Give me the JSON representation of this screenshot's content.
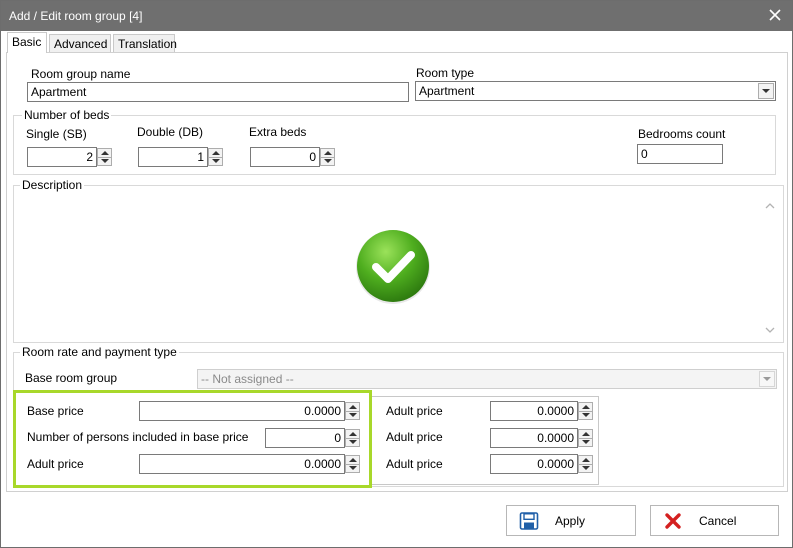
{
  "window": {
    "title": "Add / Edit room group [4]"
  },
  "tabs": [
    "Basic",
    "Advanced",
    "Translation"
  ],
  "basic": {
    "room_group_name_label": "Room group name",
    "room_group_name_value": "Apartment",
    "room_type_label": "Room type",
    "room_type_value": "Apartment",
    "beds": {
      "group_label": "Number of beds",
      "single_label": "Single (SB)",
      "single_value": "2",
      "double_label": "Double (DB)",
      "double_value": "1",
      "extra_label": "Extra beds",
      "extra_value": "0",
      "bedrooms_label": "Bedrooms count",
      "bedrooms_value": "0"
    },
    "description_label": "Description",
    "rate": {
      "group_label": "Room rate and payment type",
      "base_room_group_label": "Base room group",
      "base_room_group_value": "-- Not assigned --",
      "left": [
        {
          "label": "Base price",
          "value": "0.0000"
        },
        {
          "label": "Number of persons included in base price",
          "value": "0"
        },
        {
          "label": "Adult price",
          "value": "0.0000"
        }
      ],
      "right": [
        {
          "label": "Adult price",
          "value": "0.0000"
        },
        {
          "label": "Adult price",
          "value": "0.0000"
        },
        {
          "label": "Adult price",
          "value": "0.0000"
        }
      ]
    }
  },
  "buttons": {
    "apply": "Apply",
    "cancel": "Cancel"
  },
  "colors": {
    "titlebar": "#6f6f6f",
    "highlight": "#a8d82a",
    "check_green": "#5cb82a",
    "cancel_red": "#d42020",
    "save_blue": "#1f5fa8"
  },
  "icons": {
    "close": "close-icon",
    "check": "checkmark-icon",
    "save": "save-icon",
    "cancel": "cancel-x-icon"
  }
}
